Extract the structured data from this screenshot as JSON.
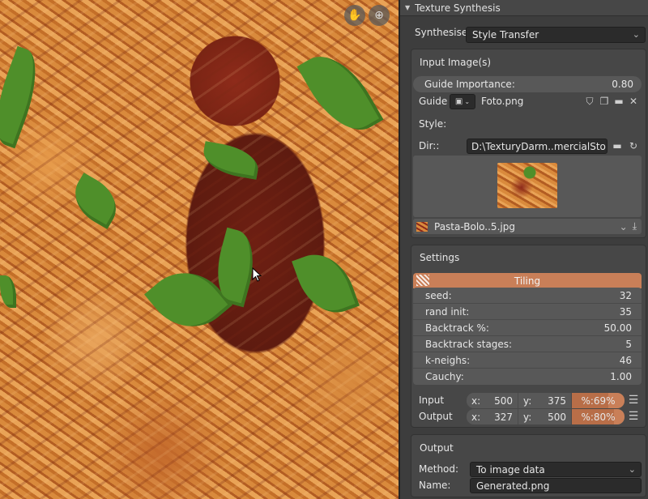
{
  "viewport": {
    "hand_icon": "hand-icon",
    "zoom_icon": "zoom-icon"
  },
  "panel": {
    "title": "Texture Synthesis"
  },
  "synthesise": {
    "label": "Synthesise:",
    "value": "Style Transfer"
  },
  "input_images": {
    "title": "Input Image(s)",
    "guide_importance_label": "Guide Importance:",
    "guide_importance_value": "0.80",
    "guide_label": "Guide",
    "guide_file": "Foto.png",
    "style_label": "Style:",
    "dir_label": "Dir::",
    "dir_value": "D:\\TexturyDarm..mercialStolen\\",
    "style_file": "Pasta-Bolo..5.jpg"
  },
  "settings": {
    "title": "Settings",
    "tiling_label": "Tiling",
    "props": [
      {
        "label": "seed:",
        "value": "32"
      },
      {
        "label": "rand init:",
        "value": "35"
      },
      {
        "label": "Backtrack %:",
        "value": "50.00"
      },
      {
        "label": "Backtrack stages:",
        "value": "5"
      },
      {
        "label": "k-neighs:",
        "value": "46"
      },
      {
        "label": "Cauchy:",
        "value": "1.00"
      }
    ],
    "input": {
      "label": "Input",
      "x_label": "x:",
      "x": "500",
      "y_label": "y:",
      "y": "375",
      "pct_label": "%:",
      "pct": "69%",
      "pct_fraction": 0.69
    },
    "output": {
      "label": "Output",
      "x_label": "x:",
      "x": "327",
      "y_label": "y:",
      "y": "500",
      "pct_label": "%:",
      "pct": "80%",
      "pct_fraction": 0.8
    }
  },
  "output_section": {
    "title": "Output",
    "method_label": "Method:",
    "method_value": "To image data",
    "name_label": "Name:",
    "name_value": "Generated.png"
  },
  "colors": {
    "accent": "#c97f58",
    "panel_bg": "#3d3d3d",
    "field": "#585858"
  }
}
